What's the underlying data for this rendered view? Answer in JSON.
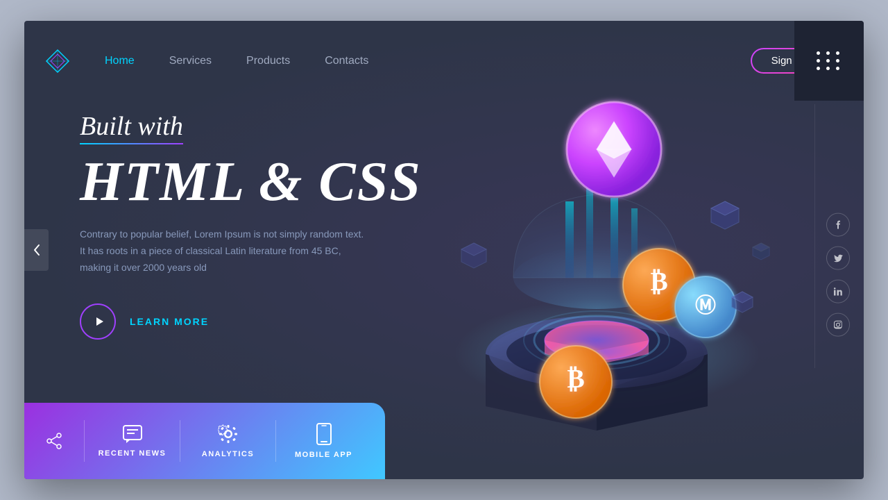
{
  "page": {
    "title": "Built with HTML & CSS",
    "background_color": "#2e3548"
  },
  "navbar": {
    "logo_alt": "diamond-logo",
    "links": [
      {
        "label": "Home",
        "active": true
      },
      {
        "label": "Services",
        "active": false
      },
      {
        "label": "Products",
        "active": false
      },
      {
        "label": "Contacts",
        "active": false
      }
    ],
    "signup_label": "Sign Up",
    "dots_label": "menu-dots"
  },
  "hero": {
    "subtitle": "Built with",
    "title": "HTML & CSS",
    "body_text": "Contrary to popular belief, Lorem Ipsum is not simply random text. It has roots in a piece of classical Latin literature from 45 BC, making it over 2000 years old",
    "cta_label": "LEARN MORE"
  },
  "bottom_bar": {
    "items": [
      {
        "label": "RECENT NEWS",
        "icon": "chat-icon"
      },
      {
        "label": "ANALYTICS",
        "icon": "gear-icon"
      },
      {
        "label": "MOBILE APP",
        "icon": "phone-icon"
      }
    ]
  },
  "social": {
    "icons": [
      {
        "label": "facebook-icon",
        "char": "f"
      },
      {
        "label": "twitter-icon",
        "char": "t"
      },
      {
        "label": "linkedin-icon",
        "char": "in"
      },
      {
        "label": "instagram-icon",
        "char": "ig"
      }
    ]
  },
  "colors": {
    "accent_cyan": "#00d4ff",
    "accent_purple": "#a040ff",
    "accent_pink": "#ff40aa",
    "nav_bg": "#1e2333",
    "main_bg": "#2e3548",
    "gradient_start": "#9b30e0",
    "gradient_end": "#40c8ff"
  }
}
